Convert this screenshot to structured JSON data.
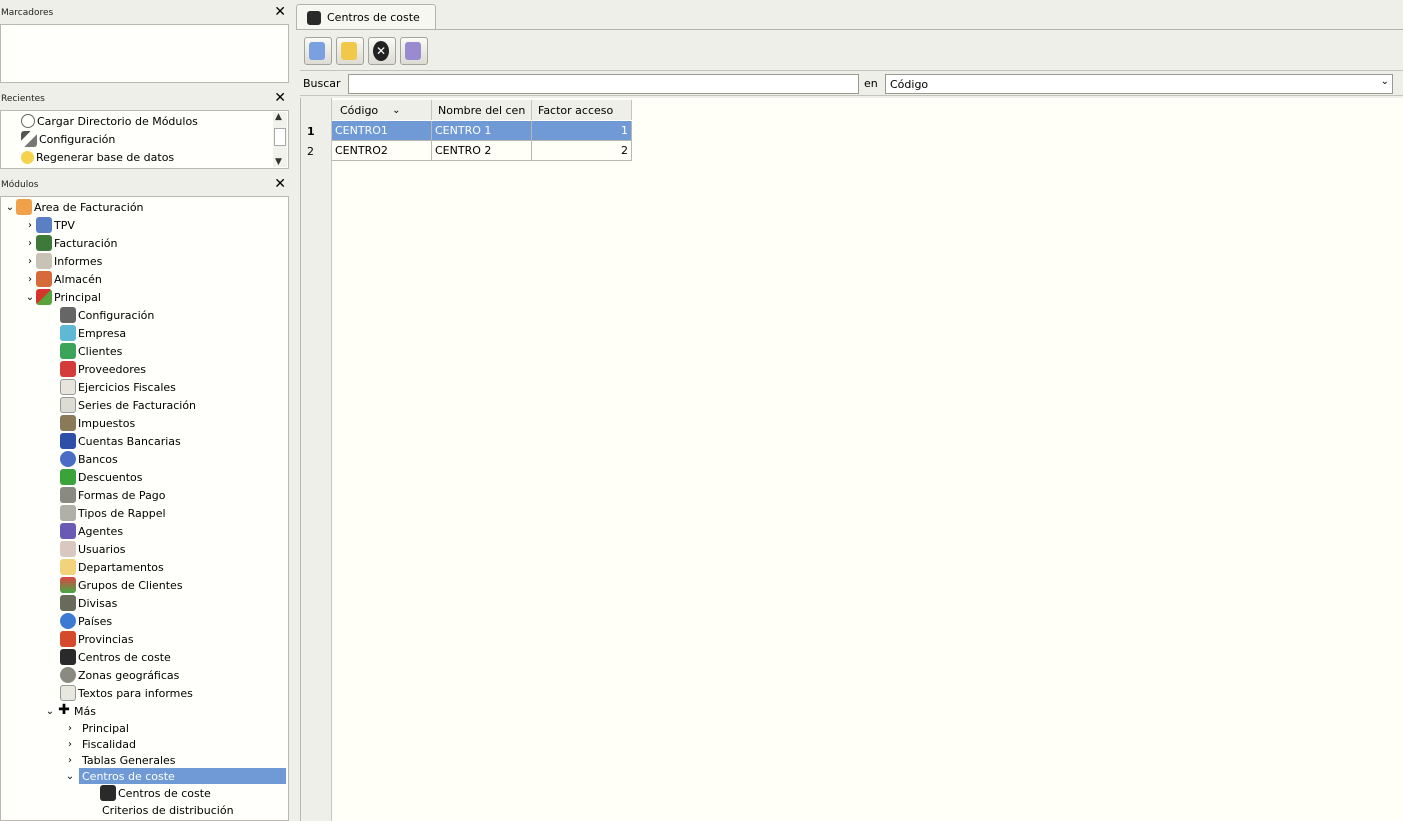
{
  "docks": {
    "bookmarks": {
      "title": "Marcadores"
    },
    "recent": {
      "title": "Recientes",
      "items": [
        "Cargar Directorio de Módulos",
        "Configuración",
        "Regenerar base de datos"
      ]
    },
    "modules": {
      "title": "Módulos",
      "root": "Area de Facturación",
      "groups": [
        "TPV",
        "Facturación",
        "Informes",
        "Almacén",
        "Principal"
      ],
      "principal_items": [
        "Configuración",
        "Empresa",
        "Clientes",
        "Proveedores",
        "Ejercicios Fiscales",
        "Series de Facturación",
        "Impuestos",
        "Cuentas Bancarias",
        "Bancos",
        "Descuentos",
        "Formas de Pago",
        "Tipos de Rappel",
        "Agentes",
        "Usuarios",
        "Departamentos",
        "Grupos de Clientes",
        "Divisas",
        "Países",
        "Provincias",
        "Centros de coste",
        "Zonas geográficas",
        "Textos para informes"
      ],
      "mas": "Más",
      "mas_items": [
        "Principal",
        "Fiscalidad",
        "Tablas Generales",
        "Centros de coste"
      ],
      "cc_items": [
        "Centros de coste",
        "Criterios de distribución"
      ]
    }
  },
  "main": {
    "tab_label": "Centros de coste",
    "search_label": "Buscar",
    "search_value": "",
    "in_label": "en",
    "search_field": "Código",
    "columns": [
      "Código",
      "Nombre del cen",
      "Factor acceso"
    ],
    "rows": [
      {
        "n": "1",
        "codigo": "CENTRO1",
        "nombre": "CENTRO 1",
        "factor": "1"
      },
      {
        "n": "2",
        "codigo": "CENTRO2",
        "nombre": "CENTRO 2",
        "factor": "2"
      }
    ]
  }
}
